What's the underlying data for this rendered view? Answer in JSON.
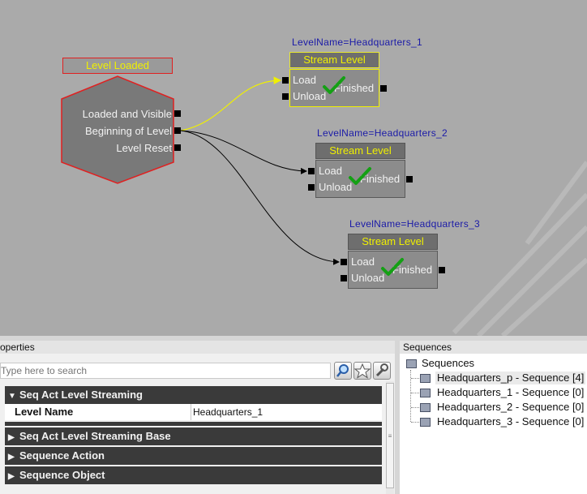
{
  "graph": {
    "level_loaded": {
      "title": "Level Loaded",
      "outputs": [
        "Loaded and Visible",
        "Beginning of Level",
        "Level Reset"
      ]
    },
    "stream_nodes": [
      {
        "levelname": "LevelName=Headquarters_1",
        "title": "Stream Level",
        "inputs": [
          "Load",
          "Unload"
        ],
        "output": "Finished",
        "selected": true
      },
      {
        "levelname": "LevelName=Headquarters_2",
        "title": "Stream Level",
        "inputs": [
          "Load",
          "Unload"
        ],
        "output": "Finished",
        "selected": false
      },
      {
        "levelname": "LevelName=Headquarters_3",
        "title": "Stream Level",
        "inputs": [
          "Load",
          "Unload"
        ],
        "output": "Finished",
        "selected": false
      }
    ],
    "colors": {
      "background": "#aaaaaa",
      "selected_link": "#f0f000",
      "link": "#000000",
      "levelname_text": "#1a1aa8"
    }
  },
  "properties": {
    "title": "operties",
    "search_placeholder": "Type here to search",
    "categories": [
      {
        "label": "Seq Act Level Streaming",
        "expanded": true
      },
      {
        "label": "Seq Act Level Streaming Base",
        "expanded": false
      },
      {
        "label": "Sequence Action",
        "expanded": false
      },
      {
        "label": "Sequence Object",
        "expanded": false
      }
    ],
    "row": {
      "name": "Level Name",
      "value": "Headquarters_1"
    }
  },
  "sequences": {
    "title": "Sequences",
    "root": "Sequences",
    "items": [
      "Headquarters_p - Sequence [4]",
      "Headquarters_1 - Sequence [0]",
      "Headquarters_2 - Sequence [0]",
      "Headquarters_3 - Sequence [0]"
    ]
  }
}
